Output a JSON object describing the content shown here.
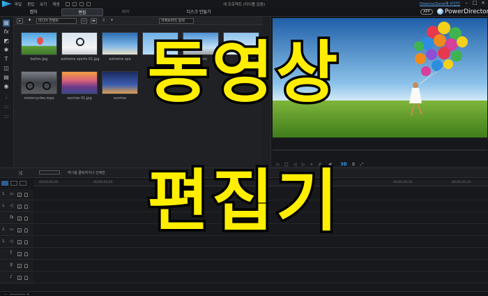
{
  "menu": {
    "items": [
      "파일",
      "편집",
      "보기",
      "재생"
    ]
  },
  "window": {
    "title": "새 프로젝트 (타이틀 없음)",
    "directorzone": "DirectorZone에 사인인"
  },
  "mode_tabs": [
    "캡처",
    "편집",
    "제작",
    "디스크 만들기"
  ],
  "brand": {
    "app_badge": "APP",
    "name": "PowerDirector"
  },
  "library": {
    "filter": "미디어 컨텐트",
    "library_menu": "라이브러리 검색",
    "items": [
      {
        "label": "ballon.jpg"
      },
      {
        "label": "extreme sports 01.jpg"
      },
      {
        "label": "extreme spo"
      },
      {
        "label": ""
      },
      {
        "label": "extrem"
      },
      {
        "label": ""
      },
      {
        "label": "motorcycles.mpo"
      },
      {
        "label": "sunrise 01.jpg"
      },
      {
        "label": "sunrise"
      }
    ]
  },
  "preview": {
    "mode_3d": "3D"
  },
  "timeline": {
    "hint": "여기를 클릭하거나 선택한",
    "ruler": [
      "00;00;00;00",
      "00;00;05;00",
      "00;00;50;10",
      "00;00;55;10"
    ],
    "tracks": [
      {
        "num": "1.",
        "icon": "video-track-icon"
      },
      {
        "num": "1.",
        "icon": "audio-track-icon"
      },
      {
        "num": "",
        "icon": "fx-track-icon"
      },
      {
        "num": "2.",
        "icon": "video-track-icon"
      },
      {
        "num": "2.",
        "icon": "audio-track-icon"
      },
      {
        "num": "",
        "icon": "title-track-icon"
      },
      {
        "num": "",
        "icon": "voice-track-icon"
      },
      {
        "num": "",
        "icon": "music-track-icon"
      }
    ]
  },
  "overlay": {
    "line1": "동영상",
    "line2": "편집기"
  },
  "colors": {
    "overlay_text": "#ffee00",
    "accent": "#3b8fe0"
  }
}
